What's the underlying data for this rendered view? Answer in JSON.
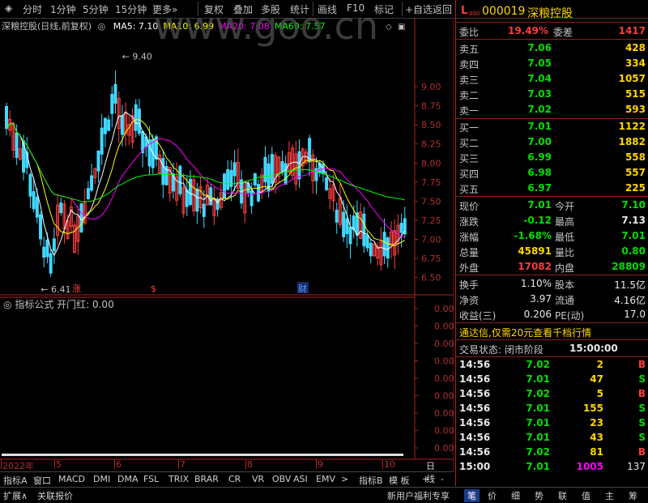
{
  "toolbar": {
    "items": [
      "分时",
      "1分钟",
      "5分钟",
      "15分钟",
      "更多»",
      "复权",
      "叠加",
      "多股",
      "统计",
      "画线",
      "F10",
      "标记",
      "+自选",
      "返回"
    ]
  },
  "chart": {
    "title": "深粮控股(日线,前复权)",
    "ma_labels": [
      {
        "text": "MA5: 7.10",
        "color": "#ffffff"
      },
      {
        "text": "MA10: 6.99",
        "color": "#ffff00"
      },
      {
        "text": "MA20: 7.08",
        "color": "#ff00ff"
      },
      {
        "text": "MA60: 7.57",
        "color": "#00ff00"
      }
    ],
    "high_label": "9.40",
    "low_label": "6.41",
    "event_labels": [
      "涨",
      "$",
      "财"
    ],
    "watermark": "www.goo.cn"
  },
  "chart_data": {
    "type": "candlestick",
    "y_ticks": [
      "9.00",
      "8.75",
      "8.50",
      "8.25",
      "8.00",
      "7.75",
      "7.50",
      "7.25",
      "7.00",
      "6.75",
      "6.50"
    ],
    "ylim": [
      6.4,
      9.5
    ],
    "x_labels": [
      "2022年",
      "5",
      "6",
      "7",
      "8",
      "9",
      "10"
    ],
    "high": 9.4,
    "low": 6.41,
    "ma_last": {
      "MA5": 7.1,
      "MA10": 6.99,
      "MA20": 7.08,
      "MA60": 7.57
    },
    "indicator": {
      "name": "开门红",
      "value": "0.00",
      "y_ticks": [
        "0.00",
        "0.00",
        "0.00",
        "0.00",
        "0.00",
        "0.00",
        "0.00",
        "0.00",
        "0.00"
      ]
    }
  },
  "indicator": {
    "title": "指标公式 开门红: 0.00"
  },
  "date_axis": {
    "labels": [
      "2022年",
      "5",
      "6",
      "7",
      "8",
      "9",
      "10"
    ],
    "right_label": "日线"
  },
  "tabs": [
    "指标A",
    "窗口",
    "MACD",
    "DMI",
    "DMA",
    "FSL",
    "TRIX",
    "BRAR",
    "CR",
    "VR",
    "OBV",
    "ASI",
    "EMV",
    ">",
    "指标B",
    "模 板",
    "+",
    "-"
  ],
  "footer": {
    "left": [
      "扩展∧",
      "关联报价"
    ],
    "promo": "新用户福利专享",
    "right": [
      "笔",
      "价",
      "细",
      "势",
      "联",
      "值",
      "主",
      "筹"
    ]
  },
  "quote": {
    "market_tag": "L",
    "market_sub": "000",
    "code": "000019",
    "name": "深粮控股",
    "weibi_label": "委比",
    "weibi": "19.49%",
    "weicha_label": "委差",
    "weicha": "1417",
    "asks": [
      {
        "label": "卖五",
        "price": "7.06",
        "vol": "428"
      },
      {
        "label": "卖四",
        "price": "7.05",
        "vol": "334"
      },
      {
        "label": "卖三",
        "price": "7.04",
        "vol": "1057"
      },
      {
        "label": "卖二",
        "price": "7.03",
        "vol": "515"
      },
      {
        "label": "卖一",
        "price": "7.02",
        "vol": "593"
      }
    ],
    "bids": [
      {
        "label": "买一",
        "price": "7.01",
        "vol": "1122"
      },
      {
        "label": "买二",
        "price": "7.00",
        "vol": "1882"
      },
      {
        "label": "买三",
        "price": "6.99",
        "vol": "558"
      },
      {
        "label": "买四",
        "price": "6.98",
        "vol": "557"
      },
      {
        "label": "买五",
        "price": "6.97",
        "vol": "225"
      }
    ],
    "stats": [
      {
        "l1": "现价",
        "v1": "7.01",
        "c1": "green",
        "l2": "今开",
        "v2": "7.10",
        "c2": "green"
      },
      {
        "l1": "涨跌",
        "v1": "-0.12",
        "c1": "green",
        "l2": "最高",
        "v2": "7.13",
        "c2": "white"
      },
      {
        "l1": "涨幅",
        "v1": "-1.68%",
        "c1": "green",
        "l2": "最低",
        "v2": "7.01",
        "c2": "green"
      },
      {
        "l1": "总量",
        "v1": "45891",
        "c1": "yellow",
        "l2": "量比",
        "v2": "0.80",
        "c2": "green"
      },
      {
        "l1": "外盘",
        "v1": "17082",
        "c1": "red",
        "l2": "内盘",
        "v2": "28809",
        "c2": "green"
      }
    ],
    "fin": [
      {
        "l1": "换手",
        "v1": "1.10%",
        "l2": "股本",
        "v2": "11.5亿"
      },
      {
        "l1": "净资",
        "v1": "3.97",
        "l2": "流通",
        "v2": "4.16亿"
      },
      {
        "l1": "收益(三)",
        "v1": "0.206",
        "l2": "PE(动)",
        "v2": "17.0"
      }
    ],
    "promo": "通达信,仅需20元查看千档行情",
    "status_label": "交易状态: 闭市阶段",
    "status_time": "15:00:00",
    "ticks": [
      {
        "time": "14:56",
        "price": "7.02",
        "vol": "2",
        "side": "B"
      },
      {
        "time": "14:56",
        "price": "7.01",
        "vol": "47",
        "side": "S"
      },
      {
        "time": "14:56",
        "price": "7.02",
        "vol": "5",
        "side": "B"
      },
      {
        "time": "14:56",
        "price": "7.01",
        "vol": "155",
        "side": "S"
      },
      {
        "time": "14:56",
        "price": "7.01",
        "vol": "23",
        "side": "S"
      },
      {
        "time": "14:56",
        "price": "7.01",
        "vol": "43",
        "side": "S"
      },
      {
        "time": "14:56",
        "price": "7.02",
        "vol": "81",
        "side": "B"
      },
      {
        "time": "15:00",
        "price": "7.01",
        "vol": "1005",
        "side": "137"
      }
    ]
  }
}
